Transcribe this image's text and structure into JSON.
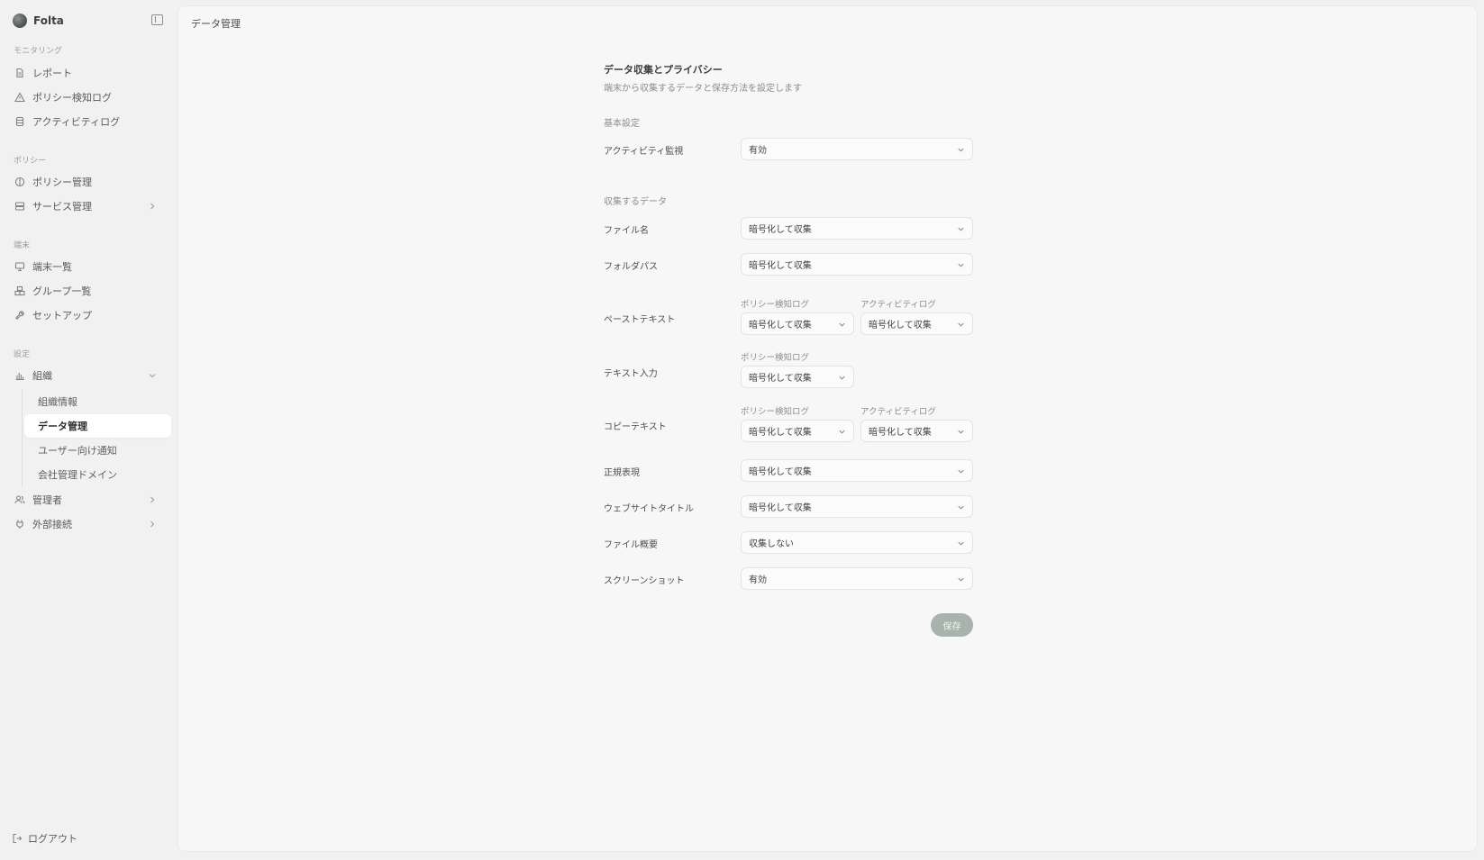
{
  "app": {
    "name": "Folta"
  },
  "sidebar": {
    "sections": {
      "monitoring": "モニタリング",
      "policy": "ポリシー",
      "devices": "端末",
      "settings": "設定"
    },
    "items": {
      "reports": "レポート",
      "policy_log": "ポリシー検知ログ",
      "activity_log": "アクティビティログ",
      "policy_mgmt": "ポリシー管理",
      "service_mgmt": "サービス管理",
      "device_list": "端末一覧",
      "group_list": "グループ一覧",
      "setup": "セットアップ",
      "org": "組織",
      "admins": "管理者",
      "integrations": "外部接続"
    },
    "org_sub": {
      "org_info": "組織情報",
      "data_mgmt": "データ管理",
      "user_notify": "ユーザー向け通知",
      "domains": "会社管理ドメイン"
    },
    "logout": "ログアウト"
  },
  "header": {
    "breadcrumb": "データ管理"
  },
  "form": {
    "title": "データ収集とプライバシー",
    "subtitle": "端末から収集するデータと保存方法を設定します",
    "basic_label": "基本設定",
    "collect_label": "収集するデータ",
    "sub_policy": "ポリシー検知ログ",
    "sub_activity": "アクティビティログ",
    "rows": {
      "activity_monitor": {
        "label": "アクティビティ監視",
        "value": "有効"
      },
      "file_name": {
        "label": "ファイル名",
        "value": "暗号化して収集"
      },
      "folder_path": {
        "label": "フォルダパス",
        "value": "暗号化して収集"
      },
      "paste_text": {
        "label": "ペーストテキスト",
        "policy": "暗号化して収集",
        "activity": "暗号化して収集"
      },
      "text_input": {
        "label": "テキスト入力",
        "policy": "暗号化して収集"
      },
      "copy_text": {
        "label": "コピーテキスト",
        "policy": "暗号化して収集",
        "activity": "暗号化して収集"
      },
      "regex": {
        "label": "正規表現",
        "value": "暗号化して収集"
      },
      "site_title": {
        "label": "ウェブサイトタイトル",
        "value": "暗号化して収集"
      },
      "file_summary": {
        "label": "ファイル概要",
        "value": "収集しない"
      },
      "screenshot": {
        "label": "スクリーンショット",
        "value": "有効"
      }
    },
    "save": "保存"
  },
  "colors": {
    "save_button": "#a8b3ad",
    "active_bg": "#ffffff",
    "canvas": "#f0f1f0",
    "panel": "#f6f7f6"
  }
}
